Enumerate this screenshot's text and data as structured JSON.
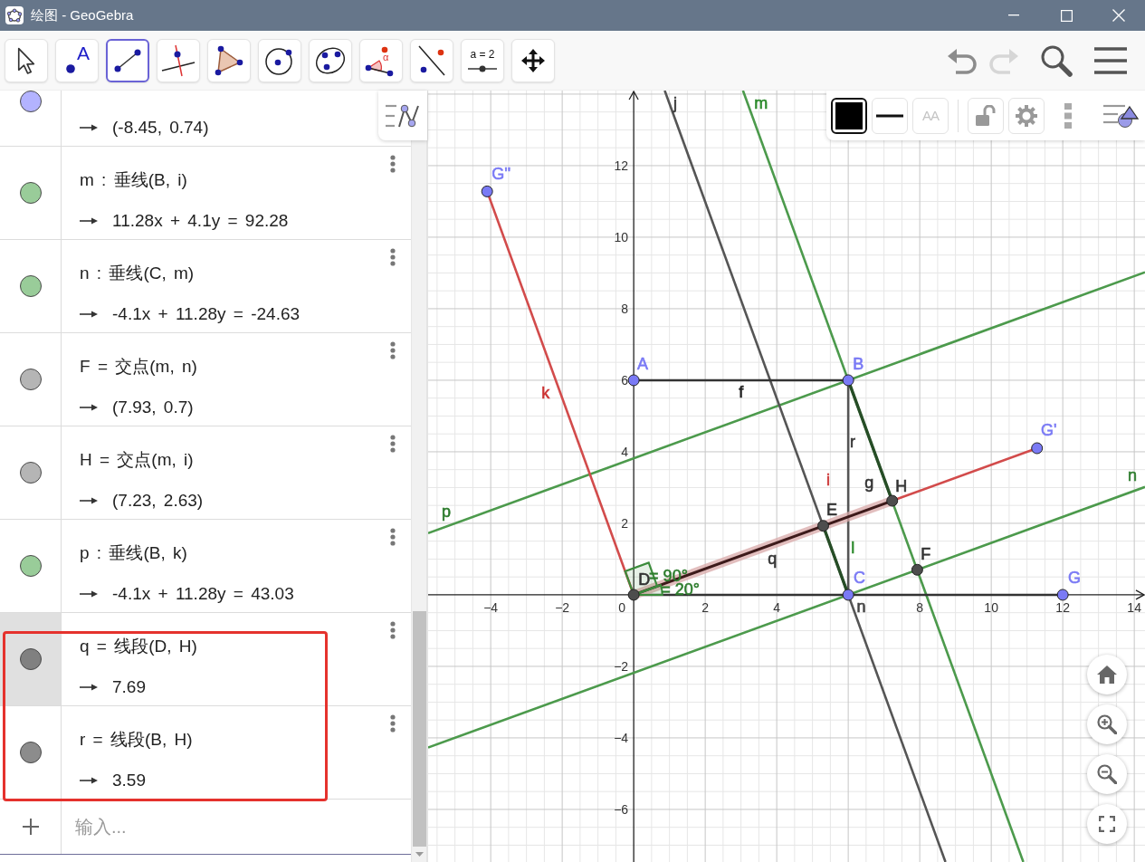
{
  "window": {
    "title": "绘图 - GeoGebra"
  },
  "toolbar": {
    "tools": [
      {
        "kind": "move",
        "selected": false
      },
      {
        "kind": "point",
        "label": "A",
        "selected": false
      },
      {
        "kind": "segment",
        "selected": true
      },
      {
        "kind": "perpendicular",
        "selected": false
      },
      {
        "kind": "polygon",
        "selected": false
      },
      {
        "kind": "circle",
        "selected": false
      },
      {
        "kind": "ellipse",
        "selected": false
      },
      {
        "kind": "angle",
        "label": "α",
        "selected": false
      },
      {
        "kind": "reflect",
        "selected": false
      },
      {
        "kind": "slider",
        "label": "a = 2",
        "selected": false
      },
      {
        "kind": "move-view",
        "selected": false
      }
    ],
    "actions": [
      {
        "kind": "undo",
        "disabled": false
      },
      {
        "kind": "redo",
        "disabled": true
      },
      {
        "kind": "search",
        "disabled": false
      },
      {
        "kind": "menu",
        "disabled": false
      }
    ]
  },
  "algebra": {
    "rows": [
      {
        "value": "(-8.45, 0.74)",
        "color": "#b3b3ff",
        "selected": false,
        "highlighted": false
      },
      {
        "definition": "m : 垂线(B, i)",
        "value": "11.28x + 4.1y = 92.28",
        "color": "#99cc99",
        "selected": false,
        "highlighted": false
      },
      {
        "definition": "n : 垂线(C, m)",
        "value": "-4.1x + 11.28y = -24.63",
        "color": "#99cc99",
        "selected": false,
        "highlighted": false
      },
      {
        "definition": "F = 交点(m, n)",
        "value": "(7.93, 0.7)",
        "color": "#b5b5b5",
        "selected": false,
        "highlighted": false
      },
      {
        "definition": "H = 交点(m, i)",
        "value": "(7.23, 2.63)",
        "color": "#b5b5b5",
        "selected": false,
        "highlighted": false
      },
      {
        "definition": "p : 垂线(B, k)",
        "value": "-4.1x + 11.28y = 43.03",
        "color": "#99cc99",
        "selected": false,
        "highlighted": false
      },
      {
        "definition": "q = 线段(D, H)",
        "value": "7.69",
        "color": "#808080",
        "selected": true,
        "highlighted": true
      },
      {
        "definition": "r = 线段(B, H)",
        "value": "3.59",
        "color": "#8c8c8c",
        "selected": false,
        "highlighted": true
      }
    ],
    "input": {
      "placeholder": "输入..."
    }
  },
  "graphics": {
    "style_bar": [
      {
        "kind": "color",
        "color": "#000000",
        "disabled": false
      },
      {
        "kind": "line-style",
        "disabled": false
      },
      {
        "kind": "text-size",
        "label": "AA",
        "disabled": true
      },
      {
        "kind": "lock",
        "disabled": false
      },
      {
        "kind": "settings",
        "disabled": false
      },
      {
        "kind": "more",
        "disabled": false
      },
      {
        "kind": "toggle",
        "disabled": false
      }
    ],
    "nav": [
      {
        "kind": "home"
      },
      {
        "kind": "zoom-in"
      },
      {
        "kind": "zoom-out"
      },
      {
        "kind": "fullscreen"
      }
    ],
    "x_axis": {
      "labels": [
        "−4",
        "−2",
        "0",
        "2",
        "4",
        "8",
        "10",
        "12",
        "14"
      ]
    },
    "y_axis": {
      "labels": [
        "12",
        "10",
        "8",
        "6",
        "4",
        "2",
        "−2",
        "−4",
        "−6"
      ]
    },
    "labels": [
      {
        "text": "j",
        "color": "#333333"
      },
      {
        "text": "m",
        "color": "#2e8b2e"
      },
      {
        "text": "G''",
        "color": "#7a7af5"
      },
      {
        "text": "A",
        "color": "#7a7af5"
      },
      {
        "text": "B",
        "color": "#7a7af5"
      },
      {
        "text": "k",
        "color": "#cc3333"
      },
      {
        "text": "f",
        "color": "#222222"
      },
      {
        "text": "G'",
        "color": "#7a7af5"
      },
      {
        "text": "r",
        "color": "#333333"
      },
      {
        "text": "i",
        "color": "#cc3333"
      },
      {
        "text": "g",
        "color": "#333333"
      },
      {
        "text": "H",
        "color": "#333333"
      },
      {
        "text": "n",
        "color": "#2e7d2e"
      },
      {
        "text": "p",
        "color": "#2a7a2a"
      },
      {
        "text": "E",
        "color": "#333333"
      },
      {
        "text": "q",
        "color": "#333333"
      },
      {
        "text": "l",
        "color": "#2e8b2e"
      },
      {
        "text": "F",
        "color": "#333333"
      },
      {
        "text": "D",
        "color": "#333333"
      },
      {
        "text": "= 90°",
        "color": "#2e7d2e"
      },
      {
        "text": "C",
        "color": "#7a7af5"
      },
      {
        "text": "G",
        "color": "#7a7af5"
      },
      {
        "text": "= 20°",
        "color": "#2e7d2e"
      },
      {
        "text": "n",
        "color": "#444444"
      }
    ]
  }
}
